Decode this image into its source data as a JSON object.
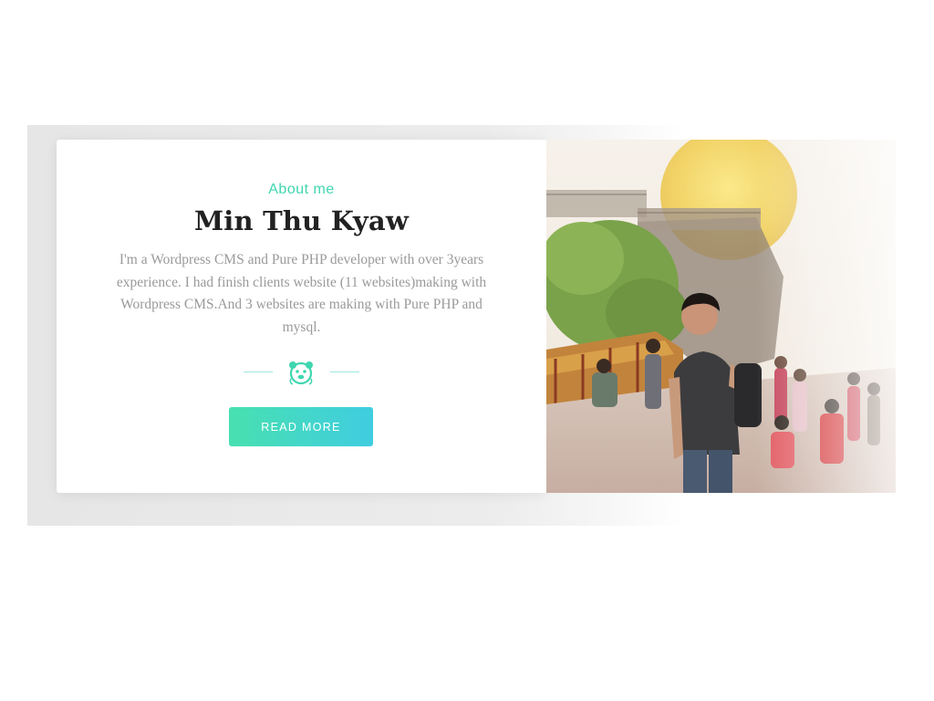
{
  "about": {
    "eyebrow": "About me",
    "name": "Min Thu Kyaw",
    "bio": "I'm a Wordpress CMS and Pure PHP developer with over 3years experience. I had finish clients website (11 websites)making with Wordpress CMS.And 3 websites are making with Pure PHP and mysql.",
    "button_label": "READ MORE"
  },
  "icons": {
    "divider_emblem": "bear-face-icon"
  },
  "colors": {
    "accent": "#3fd6b0",
    "button_gradient_start": "#48e0b0",
    "button_gradient_end": "#40cde0",
    "heading": "#222222",
    "body_text": "#9a9a9a"
  }
}
